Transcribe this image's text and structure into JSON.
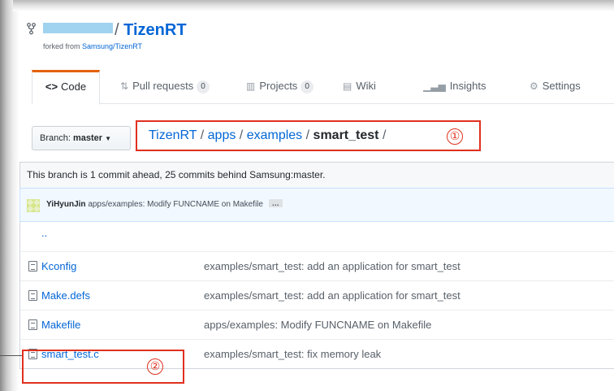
{
  "repo": {
    "name": "TizenRT",
    "slash": "/",
    "forked_prefix": "forked from ",
    "forked_source": "Samsung/TizenRT"
  },
  "tabs": [
    {
      "label": "Code",
      "icon": "code-icon",
      "selected": true
    },
    {
      "label": "Pull requests",
      "icon": "pull-request-icon",
      "count": "0"
    },
    {
      "label": "Projects",
      "icon": "project-icon",
      "count": "0"
    },
    {
      "label": "Wiki",
      "icon": "book-icon"
    },
    {
      "label": "Insights",
      "icon": "graph-icon"
    },
    {
      "label": "Settings",
      "icon": "gear-icon"
    }
  ],
  "branch": {
    "prefix": "Branch:",
    "name": "master"
  },
  "breadcrumb": {
    "root": "TizenRT",
    "seg1": "apps",
    "seg2": "examples",
    "current": "smart_test",
    "sep": "/"
  },
  "annotations": {
    "one": "①",
    "two": "②",
    "color": "#e0301e"
  },
  "branch_status": "This branch is 1 commit ahead, 25 commits behind Samsung:master.",
  "latest_commit": {
    "author": "YiHyunJin",
    "message": "apps/examples: Modify FUNCNAME on Makefile",
    "ellipsis": "…"
  },
  "files": [
    {
      "name": "..",
      "type": "parent",
      "message": ""
    },
    {
      "name": "Kconfig",
      "type": "file",
      "message": "examples/smart_test: add an application for smart_test"
    },
    {
      "name": "Make.defs",
      "type": "file",
      "message": "examples/smart_test: add an application for smart_test"
    },
    {
      "name": "Makefile",
      "type": "file",
      "message": "apps/examples: Modify FUNCNAME on Makefile"
    },
    {
      "name": "smart_test.c",
      "type": "file",
      "message": "examples/smart_test: fix memory leak"
    }
  ],
  "colors": {
    "link": "#0366d6",
    "tab_accent": "#e36209",
    "annotation": "#e0301e"
  }
}
